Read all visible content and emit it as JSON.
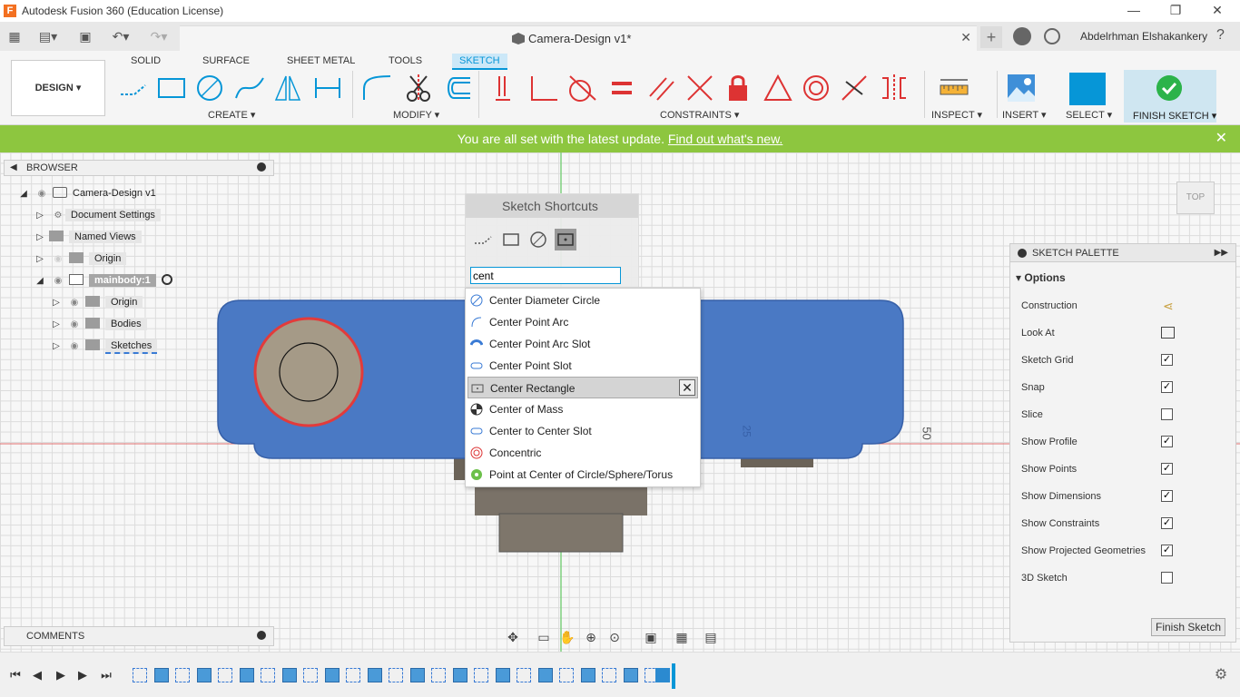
{
  "window": {
    "title": "Autodesk Fusion 360 (Education License)",
    "app_icon": "F",
    "minimize": "—",
    "maximize": "❐",
    "close": "✕"
  },
  "tabs": {
    "document_title": "Camera-Design v1*",
    "close": "✕",
    "new_tab": "+",
    "user_name": "Abdelrhman Elshakankery"
  },
  "ribbon": {
    "workspace_button": "DESIGN ▾",
    "tabs": [
      "SOLID",
      "SURFACE",
      "SHEET METAL",
      "TOOLS",
      "SKETCH"
    ],
    "active_tab": "SKETCH",
    "groups": {
      "create": "CREATE ▾",
      "modify": "MODIFY ▾",
      "constraints": "CONSTRAINTS ▾",
      "inspect": "INSPECT ▾",
      "insert": "INSERT ▾",
      "select": "SELECT ▾",
      "finish": "FINISH SKETCH ▾"
    }
  },
  "banner": {
    "message": "You are all set with the latest update.",
    "link": "Find out what's new.",
    "close": "✕"
  },
  "browser": {
    "title": "BROWSER",
    "items": [
      {
        "label": "Camera-Design v1"
      },
      {
        "label": "Document Settings"
      },
      {
        "label": "Named Views"
      },
      {
        "label": "Origin"
      },
      {
        "label": "mainbody:1"
      },
      {
        "label": "Origin"
      },
      {
        "label": "Bodies"
      },
      {
        "label": "Sketches"
      }
    ]
  },
  "comments": {
    "title": "COMMENTS"
  },
  "shortcuts": {
    "title": "Sketch Shortcuts",
    "search_value": "cent",
    "results": [
      {
        "label": "Center Diameter Circle"
      },
      {
        "label": "Center Point Arc"
      },
      {
        "label": "Center Point Arc Slot"
      },
      {
        "label": "Center Point Slot"
      },
      {
        "label": "Center Rectangle"
      },
      {
        "label": "Center of Mass"
      },
      {
        "label": "Center to Center Slot"
      },
      {
        "label": "Concentric"
      },
      {
        "label": "Point at Center of Circle/Sphere/Torus"
      }
    ],
    "selected_index": 4
  },
  "palette": {
    "title": "SKETCH PALETTE",
    "options_header": "Options",
    "rows": [
      {
        "label": "Construction"
      },
      {
        "label": "Look At"
      },
      {
        "label": "Sketch Grid",
        "checked": true
      },
      {
        "label": "Snap",
        "checked": true
      },
      {
        "label": "Slice",
        "checked": false
      },
      {
        "label": "Show Profile",
        "checked": true
      },
      {
        "label": "Show Points",
        "checked": true
      },
      {
        "label": "Show Dimensions",
        "checked": true
      },
      {
        "label": "Show Constraints",
        "checked": true
      },
      {
        "label": "Show Projected Geometries",
        "checked": true
      },
      {
        "label": "3D Sketch",
        "checked": false
      }
    ],
    "finish_button": "Finish Sketch"
  },
  "viewcube": {
    "label": "TOP"
  },
  "canvas": {
    "dim_25": "25",
    "dim_50": "50"
  },
  "colors": {
    "accent": "#0696d7",
    "banner": "#8dc63f",
    "body_blue": "#4a79c4",
    "finish_green": "#2cb34a"
  }
}
